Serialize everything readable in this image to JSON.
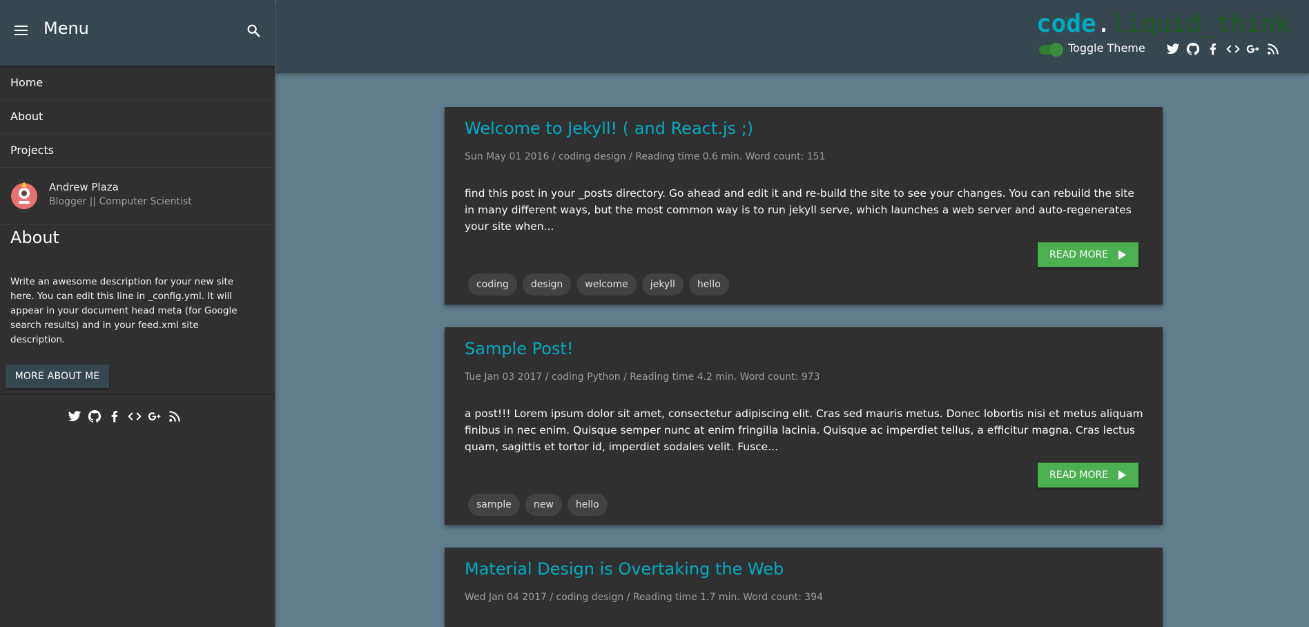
{
  "sidebar": {
    "title": "Menu",
    "nav": [
      "Home",
      "About",
      "Projects"
    ],
    "profile": {
      "name": "Andrew Plaza",
      "role": "Blogger || Computer Scientist"
    },
    "about_heading": "About",
    "about_text": "Write an awesome description for your new site here. You can edit this line in _config.yml. It will appear in your document head meta (for Google search results) and in your feed.xml site description.",
    "more_button": "MORE ABOUT ME",
    "social_icons": [
      "twitter-icon",
      "github-icon",
      "facebook-icon",
      "code-icon",
      "google-plus-icon",
      "rss-icon"
    ]
  },
  "header": {
    "logo_part1": "code",
    "logo_dot": ".",
    "logo_part2": "liquid_think",
    "toggle_label": "Toggle Theme",
    "social_icons": [
      "twitter-icon",
      "github-icon",
      "facebook-icon",
      "code-icon",
      "google-plus-icon",
      "rss-icon"
    ]
  },
  "colors": {
    "background": "#607d8b",
    "header": "#37474f",
    "card": "#303030",
    "accent": "#00acc1",
    "button": "#4caf50"
  },
  "posts": [
    {
      "title": "Welcome to Jekyll! ( and React.js ;)",
      "meta": "Sun May 01 2016 / coding design / Reading time 0.6 min. Word count: 151",
      "excerpt": "find this post in your _posts directory. Go ahead and edit it and re-build the site to see your changes. You can rebuild the site in many different ways, but the most common way is to run jekyll serve, which launches a web server and auto-regenerates your site when...",
      "button": "READ MORE",
      "tags": [
        "coding",
        "design",
        "welcome",
        "jekyll",
        "hello"
      ]
    },
    {
      "title": "Sample Post!",
      "meta": "Tue Jan 03 2017 / coding Python / Reading time 4.2 min. Word count: 973",
      "excerpt": "a post!!! Lorem ipsum dolor sit amet, consectetur adipiscing elit. Cras sed mauris metus. Donec lobortis nisi et metus aliquam finibus in nec enim. Quisque semper nunc at enim fringilla lacinia. Quisque ac imperdiet tellus, a efficitur magna. Cras lectus quam, sagittis et tortor id, imperdiet sodales velit. Fusce...",
      "button": "READ MORE",
      "tags": [
        "sample",
        "new",
        "hello"
      ]
    },
    {
      "title": "Material Design is Overtaking the Web",
      "meta": "Wed Jan 04 2017 / coding design / Reading time 1.7 min. Word count: 394"
    }
  ]
}
